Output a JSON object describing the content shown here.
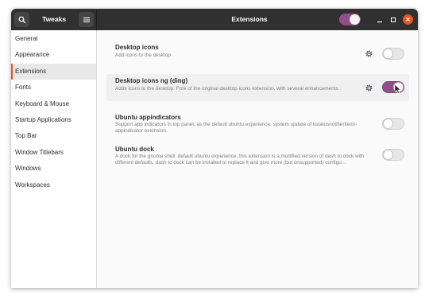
{
  "header": {
    "app_title": "Tweaks",
    "panel_title": "Extensions",
    "master_switch_on": true
  },
  "sidebar": {
    "items": [
      {
        "label": "General"
      },
      {
        "label": "Appearance"
      },
      {
        "label": "Extensions",
        "selected": true
      },
      {
        "label": "Fonts"
      },
      {
        "label": "Keyboard & Mouse"
      },
      {
        "label": "Startup Applications"
      },
      {
        "label": "Top Bar"
      },
      {
        "label": "Window Titlebars"
      },
      {
        "label": "Windows"
      },
      {
        "label": "Workspaces"
      }
    ]
  },
  "extensions": [
    {
      "name": "Desktop icons",
      "description": "Add icons to the desktop",
      "has_settings": true,
      "enabled": false
    },
    {
      "name": "Desktop icons ng (ding)",
      "description": "Adds icons to the desktop. Fork of the original desktop icons extension, with several enhancements .",
      "has_settings": true,
      "enabled": true
    },
    {
      "name": "Ubuntu appindicators",
      "description": "Support app indicators in top panel, as the default ubuntu experience. system update of kstatusnotifieritem/-appindicator extension.",
      "has_settings": false,
      "enabled": false
    },
    {
      "name": "Ubuntu dock",
      "description": "A dock for the gnome shell. default ubuntu experience. this extension is a modified version of dash to dock with different defaults. dash to dock can be installed to replace it and give more (but unsupported) configu…",
      "has_settings": false,
      "enabled": false
    }
  ],
  "colors": {
    "accent_purple": "#924d8b",
    "accent_orange": "#e95420",
    "headerbar": "#303030"
  }
}
